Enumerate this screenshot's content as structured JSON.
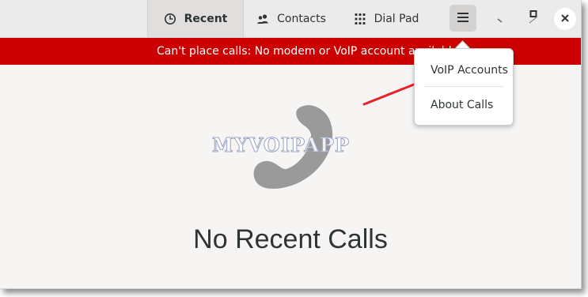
{
  "header": {
    "tabs": [
      {
        "label": "Recent",
        "icon": "clock-icon",
        "active": true
      },
      {
        "label": "Contacts",
        "icon": "contacts-icon",
        "active": false
      },
      {
        "label": "Dial Pad",
        "icon": "dialpad-icon",
        "active": false
      }
    ],
    "menu_icon": "hamburger-menu-icon",
    "window_controls": [
      "minimize-icon",
      "maximize-icon",
      "close-icon"
    ]
  },
  "banner": {
    "text": "Can't place calls: No modem or VoIP account available",
    "color": "#cc0000"
  },
  "main": {
    "icon": "phone-icon",
    "watermark": "MYVOIPAPP",
    "empty_title": "No Recent Calls"
  },
  "menu": {
    "items": [
      {
        "label": "VoIP Accounts"
      },
      {
        "label": "About Calls"
      }
    ]
  },
  "annotation": {
    "arrow_color": "#e8202a"
  }
}
